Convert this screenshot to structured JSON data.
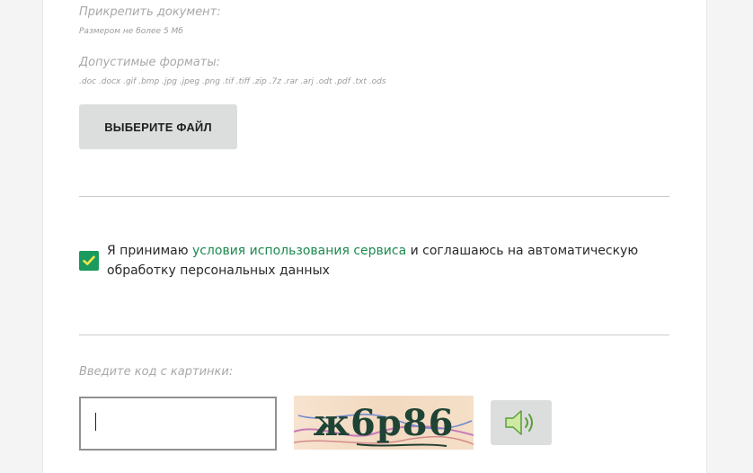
{
  "attachment": {
    "label": "Прикрепить документ:",
    "size_note": "Размером не более 5 Мб",
    "formats_label": "Допустимые форматы:",
    "formats_list": ".doc .docx .gif .bmp .jpg .jpeg .png .tif .tiff .zip .7z .rar .arj .odt .pdf .txt .ods",
    "choose_file_label": "ВЫБЕРИТЕ ФАЙЛ"
  },
  "consent": {
    "checked": true,
    "text_before": "Я принимаю ",
    "link_text": "условия использования сервиса",
    "text_after": " и соглашаюсь на автоматическую обработку персональных данных"
  },
  "captcha": {
    "label": "Введите код с картинки:",
    "input_value": "",
    "image_text": "ж6р86",
    "audio_icon": "speaker-icon"
  },
  "colors": {
    "accent_green": "#1b9a5d",
    "link_green": "#1b8a4f",
    "button_gray": "#dcdedd",
    "checkmark_yellow": "#f2e64a"
  }
}
